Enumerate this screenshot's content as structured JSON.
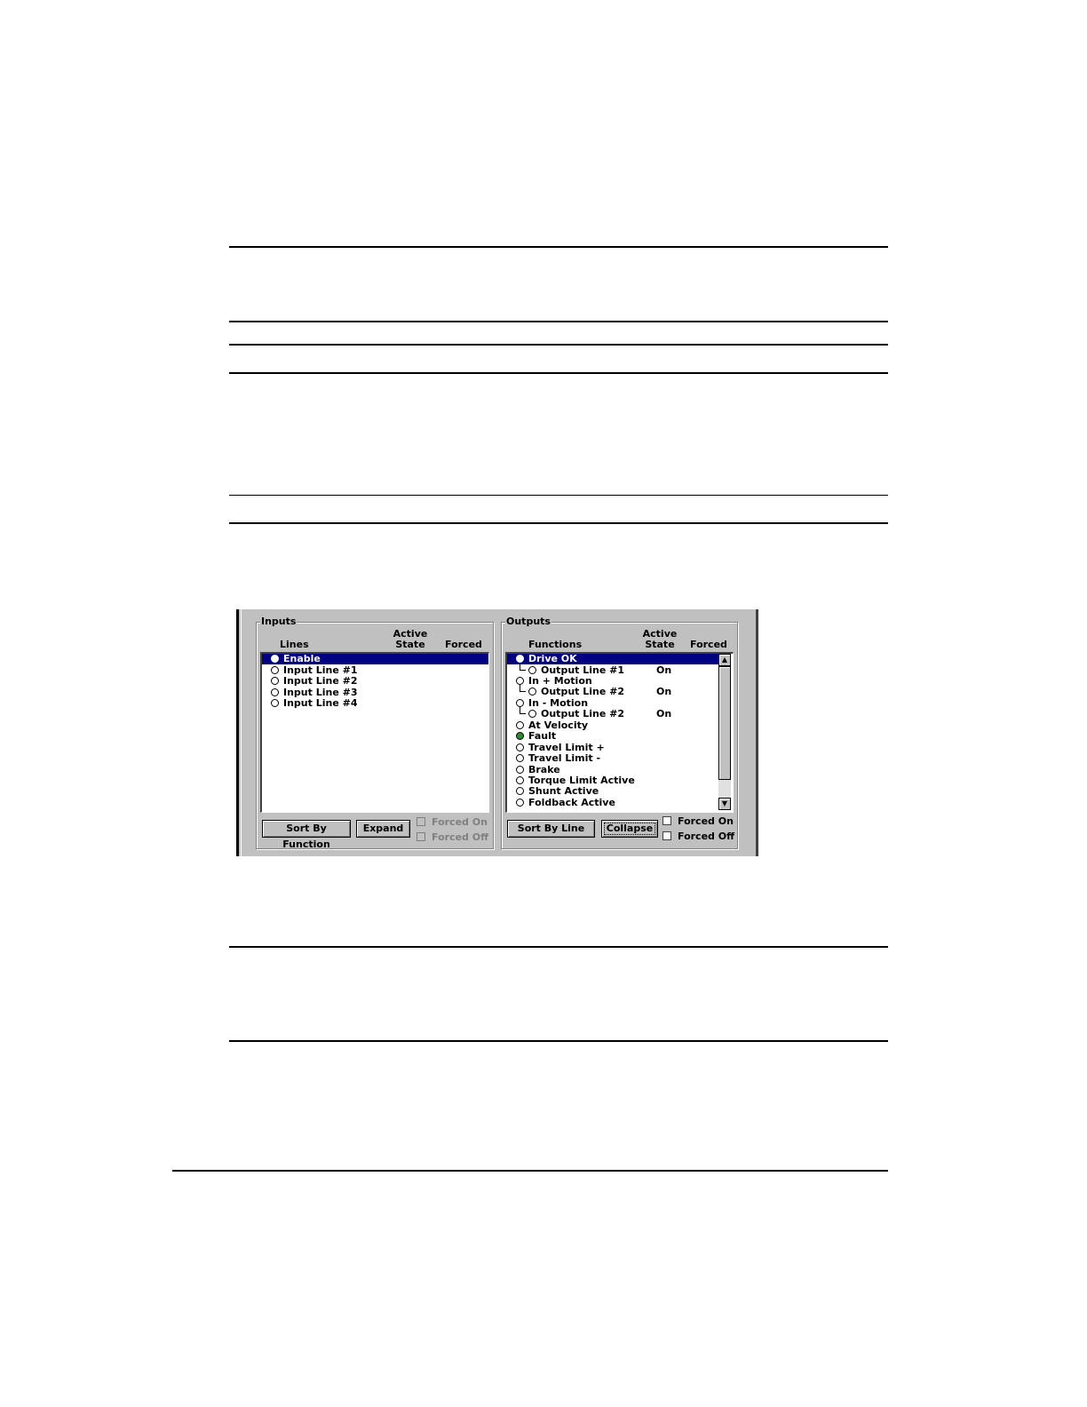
{
  "inputs": {
    "title": "Inputs",
    "col_lines": "Lines",
    "col_active_state": [
      "Active",
      "State"
    ],
    "col_forced": "Forced",
    "rows": [
      {
        "label": "Enable",
        "selected": true
      },
      {
        "label": "Input Line #1"
      },
      {
        "label": "Input Line #2"
      },
      {
        "label": "Input Line #3"
      },
      {
        "label": "Input Line #4"
      }
    ],
    "sort_button": "Sort By Function",
    "expand_button": "Expand",
    "forced_on": "Forced On",
    "forced_off": "Forced Off"
  },
  "outputs": {
    "title": "Outputs",
    "col_functions": "Functions",
    "col_active_state": [
      "Active",
      "State"
    ],
    "col_forced": "Forced",
    "rows": [
      {
        "label": "Drive OK",
        "selected": true
      },
      {
        "label": "Output Line #1",
        "state": "On",
        "child": true
      },
      {
        "label": "In + Motion"
      },
      {
        "label": "Output Line #2",
        "state": "On",
        "child": true
      },
      {
        "label": "In - Motion"
      },
      {
        "label": "Output Line #2",
        "state": "On",
        "child": true
      },
      {
        "label": "At Velocity"
      },
      {
        "label": "Fault",
        "indicator": "#2e8b2e"
      },
      {
        "label": "Travel Limit +"
      },
      {
        "label": "Travel Limit -"
      },
      {
        "label": "Brake"
      },
      {
        "label": "Torque Limit Active"
      },
      {
        "label": "Shunt Active"
      },
      {
        "label": "Foldback Active"
      }
    ],
    "sort_button": "Sort By Line",
    "collapse_button": "Collapse",
    "forced_on": "Forced On",
    "forced_off": "Forced Off"
  },
  "scroll_icons": {
    "up": "scroll-up-arrow-icon",
    "down": "scroll-down-arrow-icon"
  }
}
